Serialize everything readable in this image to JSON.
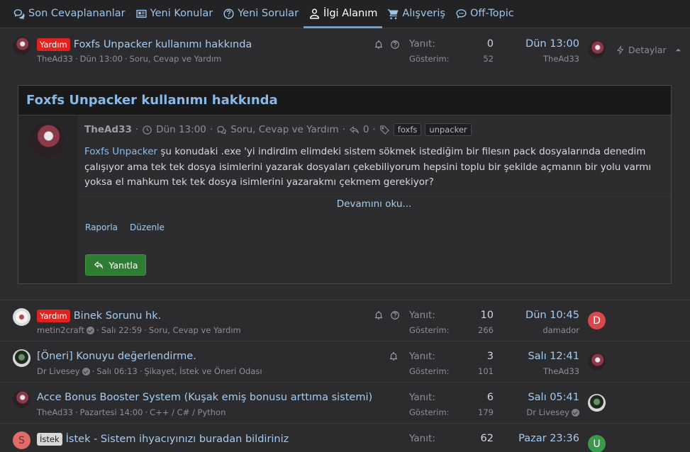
{
  "nav": {
    "tabs": [
      {
        "label": "Son Cevaplananlar",
        "icon": "comments-icon",
        "active": false
      },
      {
        "label": "Yeni Konular",
        "icon": "news-icon",
        "active": false
      },
      {
        "label": "Yeni Sorular",
        "icon": "question-icon",
        "active": false
      },
      {
        "label": "İlgi Alanım",
        "icon": "user-icon",
        "active": true
      },
      {
        "label": "Alışveriş",
        "icon": "cart-icon",
        "active": false
      },
      {
        "label": "Off-Topic",
        "icon": "chat-icon",
        "active": false
      }
    ]
  },
  "labels": {
    "replies": "Yanıt:",
    "views": "Gösterim:",
    "details": "Detaylar"
  },
  "threads": [
    {
      "prefix": "Yardım",
      "title": "Foxfs Unpacker kullanımı hakkında",
      "author": "TheAd33",
      "date": "Dün 13:00",
      "forum": "Soru, Cevap ve Yardım",
      "replies": "0",
      "views": "52",
      "last_date": "Dün 13:00",
      "last_user": "TheAd33"
    },
    {
      "prefix": "Yardım",
      "title": "Binek Sorunu hk.",
      "author": "metin2craft",
      "date": "Salı 22:59",
      "forum": "Soru, Cevap ve Yardım",
      "replies": "10",
      "views": "266",
      "last_date": "Dün 10:45",
      "last_user": "damador",
      "last_avatar_letter": "D"
    },
    {
      "prefix": "",
      "title": "[Öneri] Konuyu değerlendirme.",
      "author": "Dr Livesey",
      "date": "Salı 06:13",
      "forum": "Şikayet, İstek ve Öneri Odası",
      "replies": "3",
      "views": "101",
      "last_date": "Salı 12:41",
      "last_user": "TheAd33"
    },
    {
      "prefix": "",
      "title": "Acce Bonus Booster System (Kuşak emiş bonusu arttıma sistemi)",
      "author": "TheAd33",
      "date": "Pazartesi 14:00",
      "forum": "C++ / C# / Python",
      "replies": "6",
      "views": "179",
      "last_date": "Salı 05:41",
      "last_user": "Dr Livesey"
    },
    {
      "prefix": "İstek",
      "title": "İstek - Sistem ihyacıyınızı buradan bildiriniz",
      "author_avatar_letter": "S",
      "replies": "62",
      "last_date": "Pazar 23:36",
      "last_avatar_letter": "U"
    }
  ],
  "preview": {
    "title": "Foxfs Unpacker kullanımı hakkında",
    "author": "TheAd33",
    "date": "Dün 13:00",
    "forum": "Soru, Cevap ve Yardım",
    "reply_count": "0",
    "tags": [
      "foxfs",
      "unpacker"
    ],
    "text_link": "Foxfs Unpacker",
    "text_rest": " şu konudaki .exe 'yi indirdim elimdeki sistem sökmek istediğim bir filesın pack dosyalarında denedim çalışıyor ama tek tek dosya isimlerini yazarak dosyaları çekebiliyorum hepsini toplu bir şekilde açmanın bir yolu varmı yoksa el mahkum tek tek dosya isimlerini yazarakmı çekmem gerekiyor?",
    "read_more": "Devamını oku...",
    "actions": [
      "Raporla",
      "Düzenle"
    ],
    "reply_button": "Yanıtla"
  },
  "colors": {
    "accent": "#6a9fd8",
    "link": "#a6cbf0",
    "prefix_red": "#e0211d",
    "reply_green": "#2e7d32"
  }
}
